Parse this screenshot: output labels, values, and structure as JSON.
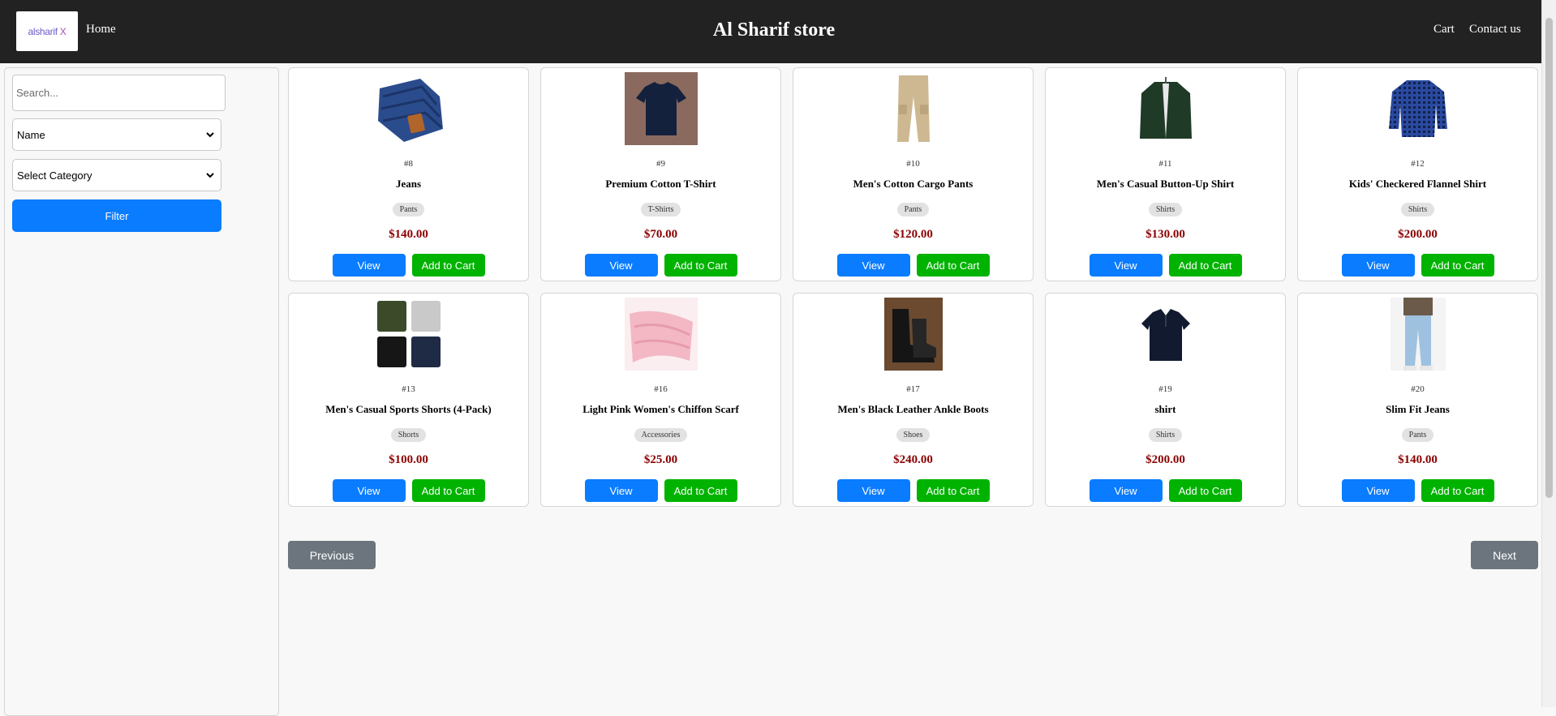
{
  "header": {
    "logo_text": "alsharif",
    "logo_mark": "X",
    "home_label": "Home",
    "title": "Al Sharif store",
    "cart_label": "Cart",
    "contact_label": "Contact us"
  },
  "sidebar": {
    "search_placeholder": "Search...",
    "sort_selected": "Name",
    "category_selected": "Select Category",
    "filter_label": "Filter"
  },
  "buttons": {
    "view": "View",
    "add_to_cart": "Add to Cart"
  },
  "products": [
    {
      "id": "#8",
      "name": "Jeans",
      "category": "Pants",
      "price": "$140.00",
      "image": "jeans"
    },
    {
      "id": "#9",
      "name": "Premium Cotton T-Shirt",
      "category": "T-Shirts",
      "price": "$70.00",
      "image": "tshirt"
    },
    {
      "id": "#10",
      "name": "Men's Cotton Cargo Pants",
      "category": "Pants",
      "price": "$120.00",
      "image": "cargo-pants"
    },
    {
      "id": "#11",
      "name": "Men's Casual Button-Up Shirt",
      "category": "Shirts",
      "price": "$130.00",
      "image": "button-shirt"
    },
    {
      "id": "#12",
      "name": "Kids' Checkered Flannel Shirt",
      "category": "Shirts",
      "price": "$200.00",
      "image": "flannel-shirt"
    },
    {
      "id": "#13",
      "name": "Men's Casual Sports Shorts (4-Pack)",
      "category": "Shorts",
      "price": "$100.00",
      "image": "shorts-pack"
    },
    {
      "id": "#16",
      "name": "Light Pink Women's Chiffon Scarf",
      "category": "Accessories",
      "price": "$25.00",
      "image": "scarf"
    },
    {
      "id": "#17",
      "name": "Men's Black Leather Ankle Boots",
      "category": "Shoes",
      "price": "$240.00",
      "image": "boots"
    },
    {
      "id": "#19",
      "name": "shirt",
      "category": "Shirts",
      "price": "$200.00",
      "image": "polo-shirt"
    },
    {
      "id": "#20",
      "name": "Slim Fit Jeans",
      "category": "Pants",
      "price": "$140.00",
      "image": "slim-jeans"
    }
  ],
  "pagination": {
    "previous": "Previous",
    "next": "Next"
  },
  "colors": {
    "header_bg": "#222222",
    "view_button": "#0a7cff",
    "cart_button": "#00b300",
    "price": "#8b0000",
    "pager_button": "#6c757d"
  }
}
